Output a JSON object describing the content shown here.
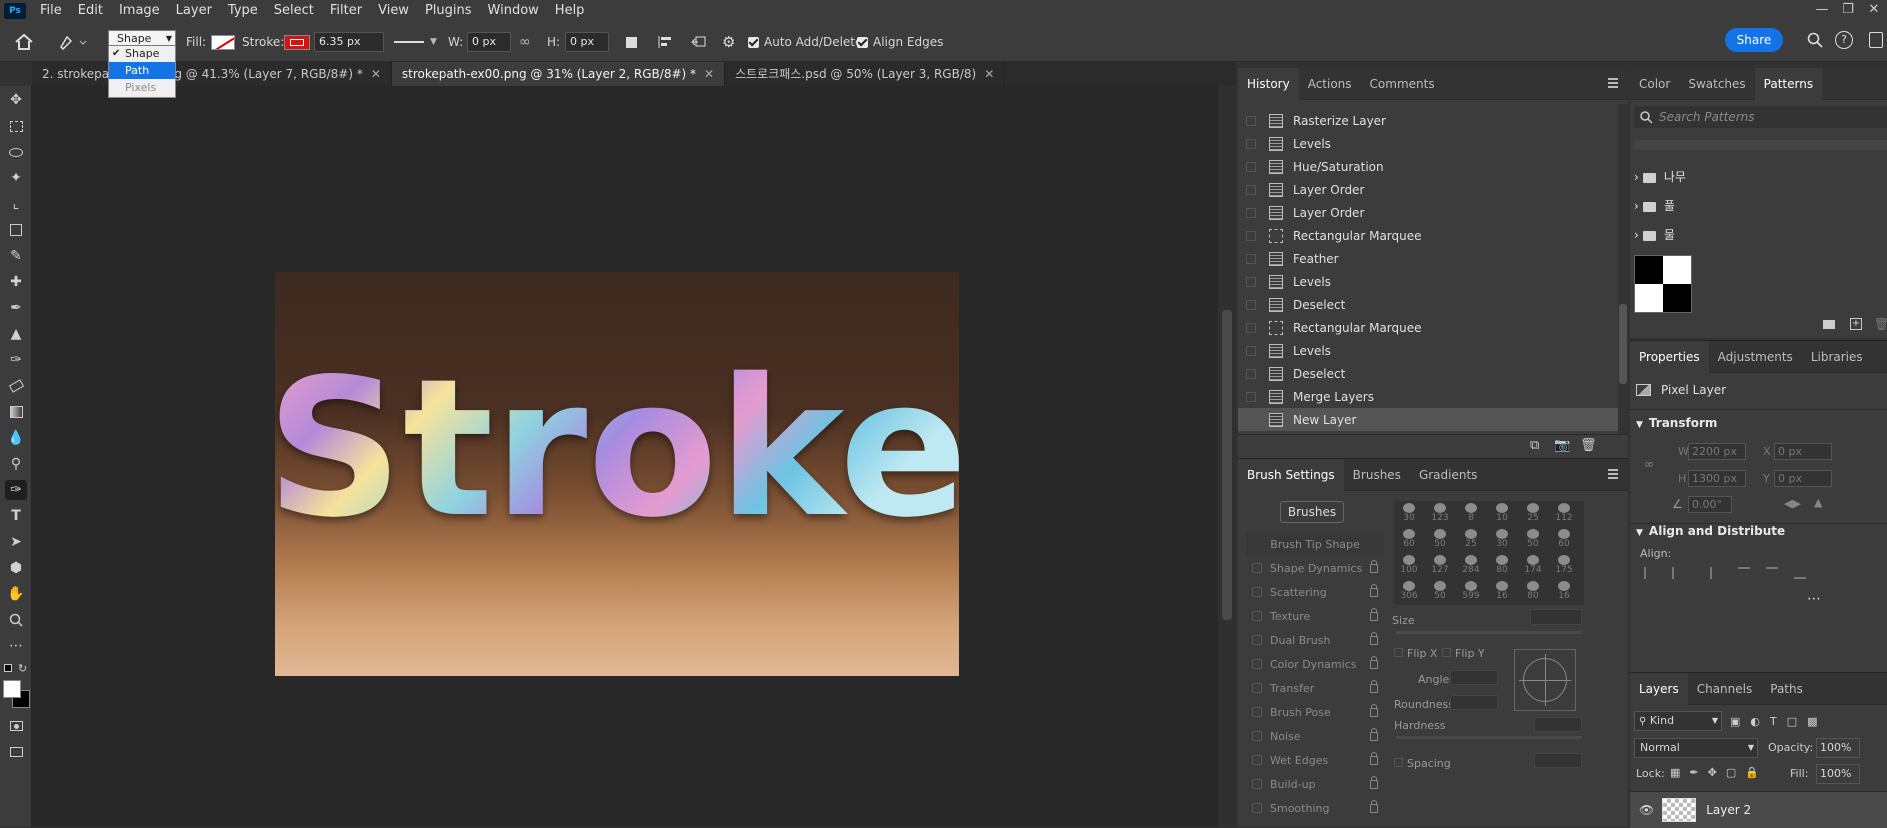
{
  "app": {
    "logo": "Ps"
  },
  "menu": [
    "File",
    "Edit",
    "Image",
    "Layer",
    "Type",
    "Select",
    "Filter",
    "View",
    "Plugins",
    "Window",
    "Help"
  ],
  "options": {
    "mode_selected": "Shape",
    "mode_options": [
      "Shape",
      "Path",
      "Pixels"
    ],
    "fill_label": "Fill:",
    "stroke_label": "Stroke:",
    "stroke_width": "6.35 px",
    "w_label": "W:",
    "w_value": "0 px",
    "h_label": "H:",
    "h_value": "0 px",
    "auto_add_delete": "Auto Add/Delete",
    "align_edges": "Align Edges",
    "share": "Share"
  },
  "tabs": [
    {
      "label": "2. strokepath-ex00.png @ 41.3% (Layer 7, RGB/8#) *",
      "active": false
    },
    {
      "label": "strokepath-ex00.png @ 31% (Layer 2, RGB/8#) *",
      "active": true
    },
    {
      "label": "스트로크패스.psd @ 50% (Layer 3, RGB/8)",
      "active": false
    }
  ],
  "canvas": {
    "artwork_text": "Stroke"
  },
  "history": {
    "tabs": [
      "History",
      "Actions",
      "Comments"
    ],
    "items": [
      {
        "label": "Rasterize Layer",
        "icon": "doc-icon"
      },
      {
        "label": "Levels",
        "icon": "doc-icon"
      },
      {
        "label": "Hue/Saturation",
        "icon": "doc-icon"
      },
      {
        "label": "Layer Order",
        "icon": "doc-icon"
      },
      {
        "label": "Layer Order",
        "icon": "doc-icon"
      },
      {
        "label": "Rectangular Marquee",
        "icon": "marquee-icon"
      },
      {
        "label": "Feather",
        "icon": "doc-icon"
      },
      {
        "label": "Levels",
        "icon": "doc-icon"
      },
      {
        "label": "Deselect",
        "icon": "doc-icon"
      },
      {
        "label": "Rectangular Marquee",
        "icon": "marquee-icon"
      },
      {
        "label": "Levels",
        "icon": "doc-icon"
      },
      {
        "label": "Deselect",
        "icon": "doc-icon"
      },
      {
        "label": "Merge Layers",
        "icon": "doc-icon"
      },
      {
        "label": "New Layer",
        "icon": "doc-icon"
      }
    ]
  },
  "brush": {
    "tabs": [
      "Brush Settings",
      "Brushes",
      "Gradients"
    ],
    "brushes_button": "Brushes",
    "settings": [
      {
        "label": "Brush Tip Shape",
        "lock": false
      },
      {
        "label": "Shape Dynamics",
        "lock": true
      },
      {
        "label": "Scattering",
        "lock": true
      },
      {
        "label": "Texture",
        "lock": true
      },
      {
        "label": "Dual Brush",
        "lock": true
      },
      {
        "label": "Color Dynamics",
        "lock": true
      },
      {
        "label": "Transfer",
        "lock": true
      },
      {
        "label": "Brush Pose",
        "lock": true
      },
      {
        "label": "Noise",
        "lock": true
      },
      {
        "label": "Wet Edges",
        "lock": true
      },
      {
        "label": "Build-up",
        "lock": true
      },
      {
        "label": "Smoothing",
        "lock": true
      }
    ],
    "tip_sizes": [
      "30",
      "123",
      "8",
      "10",
      "25",
      "112",
      "60",
      "50",
      "25",
      "30",
      "50",
      "60",
      "100",
      "127",
      "284",
      "80",
      "174",
      "175",
      "306",
      "50",
      "599",
      "16",
      "80",
      "16"
    ],
    "size_label": "Size",
    "flip_x": "Flip X",
    "flip_y": "Flip Y",
    "angle_label": "Angle:",
    "roundness_label": "Roundness:",
    "hardness_label": "Hardness",
    "spacing_label": "Spacing"
  },
  "patterns": {
    "tabs": [
      "Color",
      "Swatches",
      "Patterns"
    ],
    "search_placeholder": "Search Patterns",
    "folders": [
      "나무",
      "풀",
      "물"
    ]
  },
  "properties": {
    "tabs": [
      "Properties",
      "Adjustments",
      "Libraries"
    ],
    "layer_type": "Pixel Layer",
    "transform_title": "Transform",
    "w_label": "W",
    "w_value": "2200 px",
    "x_label": "X",
    "x_value": "0 px",
    "h_label": "H",
    "h_value": "1300 px",
    "y_label": "Y",
    "y_value": "0 px",
    "angle_value": "0.00°",
    "align_title": "Align and Distribute",
    "align_label": "Align:"
  },
  "layers": {
    "tabs": [
      "Layers",
      "Channels",
      "Paths"
    ],
    "filter_kind": "Kind",
    "blend_mode": "Normal",
    "opacity_label": "Opacity:",
    "opacity_value": "100%",
    "lock_label": "Lock:",
    "fill_label": "Fill:",
    "fill_value": "100%",
    "layer_name": "Layer 2"
  }
}
